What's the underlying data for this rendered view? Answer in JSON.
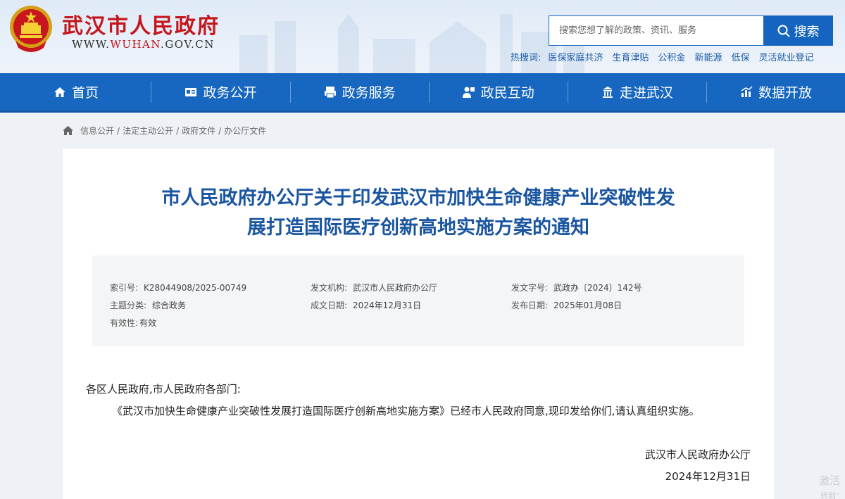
{
  "header": {
    "site_title": "武汉市人民政府",
    "site_url_prefix": "WWW.",
    "site_url_accent": "WUHAN",
    "site_url_suffix": ".GOV.CN",
    "search_placeholder": "搜索您想了解的政策、资讯、服务",
    "search_button": "搜索",
    "hot_label": "热搜词:",
    "hot_terms": [
      "医保家庭共济",
      "生育津贴",
      "公积金",
      "新能源",
      "低保",
      "灵活就业登记"
    ]
  },
  "nav": {
    "items": [
      {
        "label": "首页",
        "icon": "home-icon"
      },
      {
        "label": "政务公开",
        "icon": "id-card-icon"
      },
      {
        "label": "政务服务",
        "icon": "printer-icon"
      },
      {
        "label": "政民互动",
        "icon": "people-icon"
      },
      {
        "label": "走进武汉",
        "icon": "building-icon"
      },
      {
        "label": "数据开放",
        "icon": "chart-icon"
      }
    ]
  },
  "breadcrumb": [
    "信息公开",
    "法定主动公开",
    "政府文件",
    "办公厅文件"
  ],
  "article": {
    "title_line1": "市人民政府办公厅关于印发武汉市加快生命健康产业突破性发",
    "title_line2": "展打造国际医疗创新高地实施方案的通知",
    "meta": {
      "index_label": "索引号:",
      "index_value": "K28044908/2025-00749",
      "issuer_label": "发文机构:",
      "issuer_value": "武汉市人民政府办公厅",
      "docno_label": "发文字号:",
      "docno_value": "武政办〔2024〕142号",
      "topic_label": "主题分类:",
      "topic_value": "综合政务",
      "created_label": "成文日期:",
      "created_value": "2024年12月31日",
      "published_label": "发布日期:",
      "published_value": "2025年01月08日",
      "validity_label": "有效性:",
      "validity_value": "有效"
    },
    "salutation": "各区人民政府,市人民政府各部门:",
    "paragraph": "《武汉市加快生命健康产业突破性发展打造国际医疗创新高地实施方案》已经市人民政府同意,现印发给你们,请认真组织实施。",
    "signature": "武汉市人民政府办公厅",
    "date": "2024年12月31日"
  },
  "watermark": {
    "line1": "激活",
    "line2": "转到\""
  },
  "colors": {
    "brand_red": "#c4171d",
    "nav_blue": "#1767c0",
    "title_blue": "#1a55a0"
  }
}
